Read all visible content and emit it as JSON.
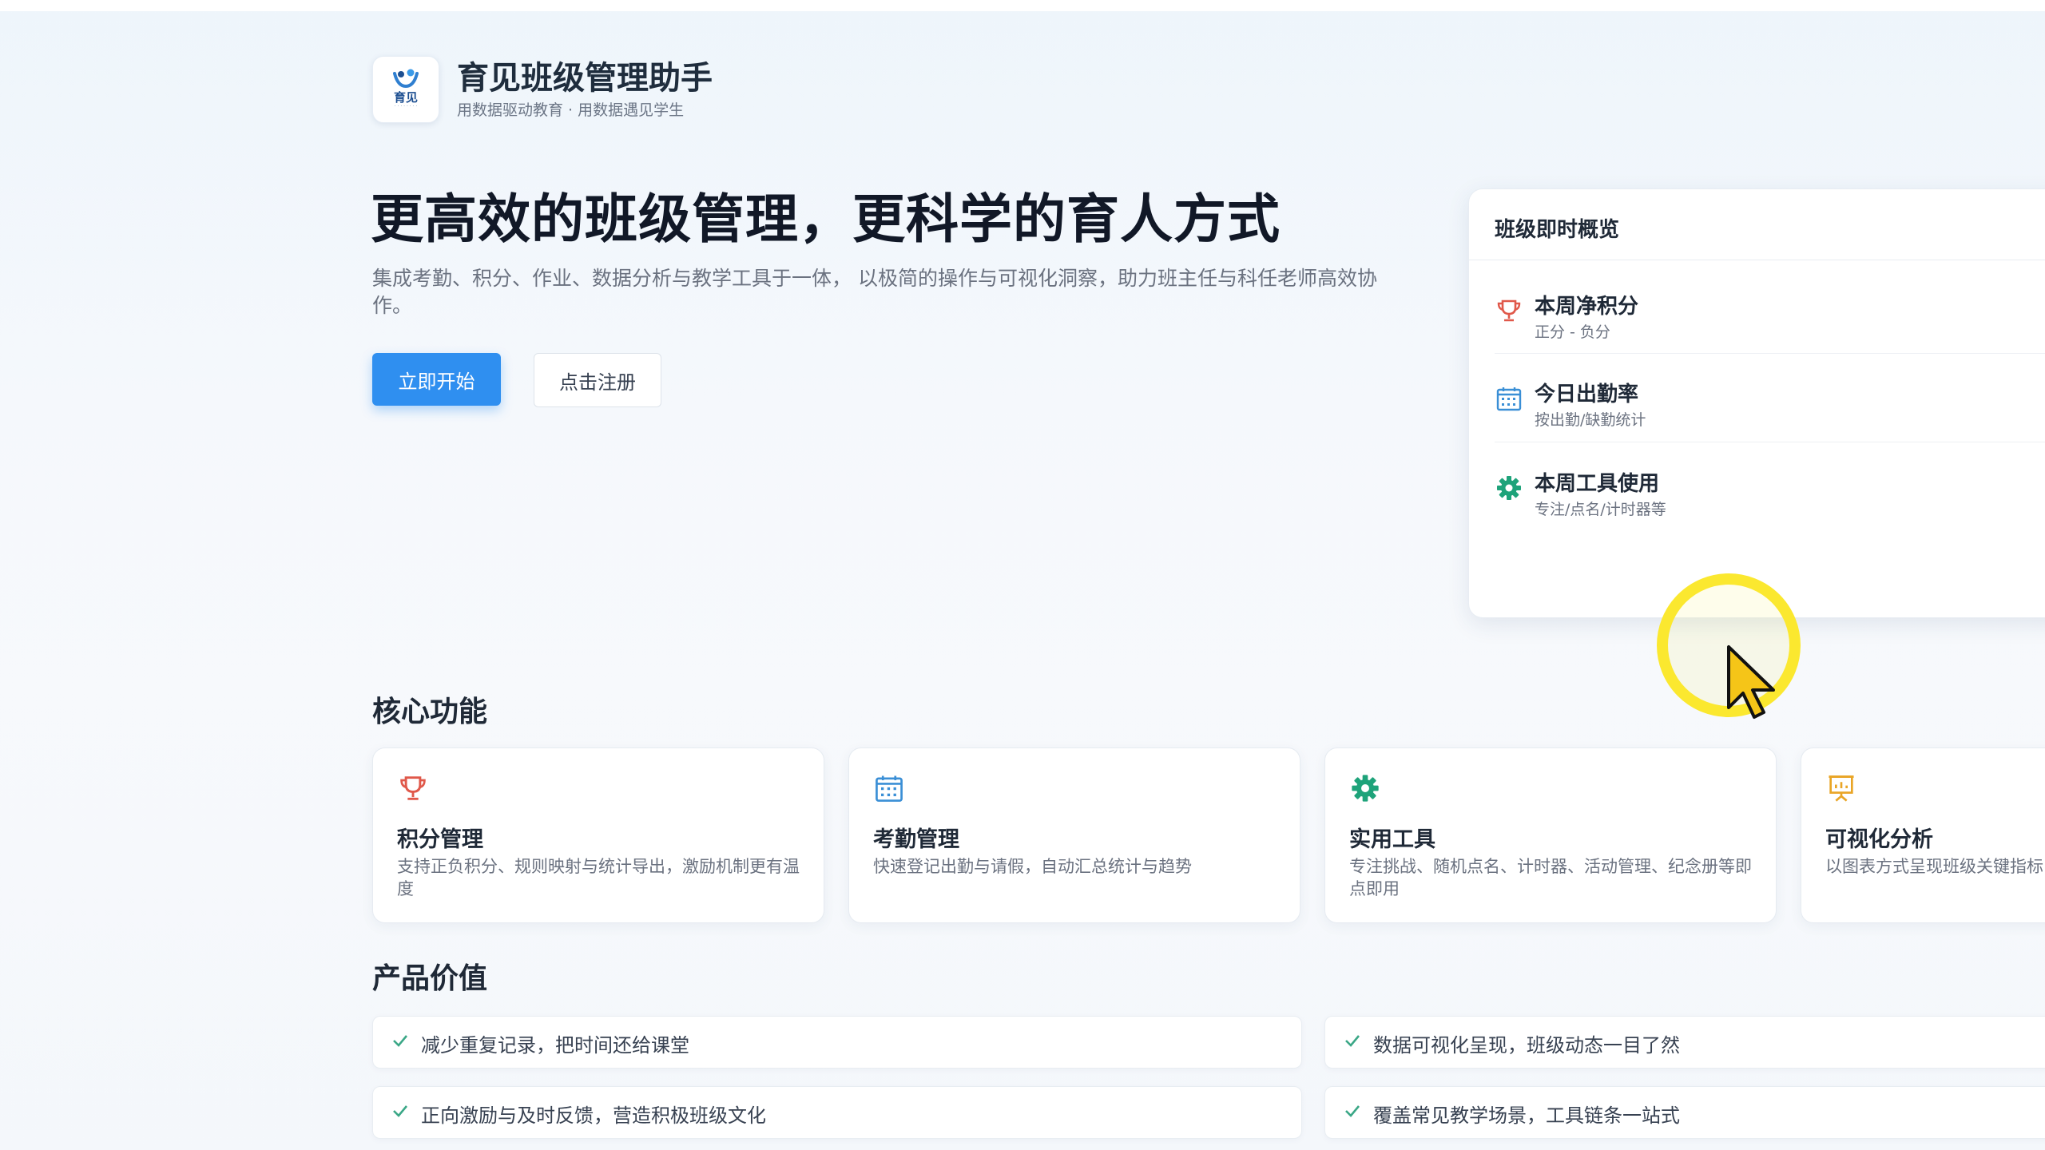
{
  "brand": {
    "logo_text": "育见",
    "title": "育见班级管理助手",
    "slogan": "用数据驱动教育 · 用数据遇见学生"
  },
  "hero": {
    "title": "更高效的班级管理，更科学的育人方式",
    "description": "集成考勤、积分、作业、数据分析与教学工具于一体， 以极简的操作与可视化洞察，助力班主任与科任老师高效协作。",
    "primary_button": "立即开始",
    "secondary_button": "点击注册"
  },
  "overview": {
    "title": "班级即时概览",
    "items": [
      {
        "icon": "trophy-icon",
        "label": "本周净积分",
        "sub": "正分 - 负分"
      },
      {
        "icon": "calendar-icon",
        "label": "今日出勤率",
        "sub": "按出勤/缺勤统计"
      },
      {
        "icon": "gear-icon",
        "label": "本周工具使用",
        "sub": "专注/点名/计时器等"
      }
    ]
  },
  "features": {
    "title": "核心功能",
    "items": [
      {
        "icon": "trophy-icon",
        "title": "积分管理",
        "desc": "支持正负积分、规则映射与统计导出，激励机制更有温度"
      },
      {
        "icon": "calendar-icon",
        "title": "考勤管理",
        "desc": "快速登记出勤与请假，自动汇总统计与趋势"
      },
      {
        "icon": "gear-icon",
        "title": "实用工具",
        "desc": "专注挑战、随机点名、计时器、活动管理、纪念册等即点即用"
      },
      {
        "icon": "presentation-chart-icon",
        "title": "可视化分析",
        "desc": "以图表方式呈现班级关键指标"
      }
    ]
  },
  "values": {
    "title": "产品价值",
    "items": [
      "减少重复记录，把时间还给课堂",
      "数据可视化呈现，班级动态一目了然",
      "正向激励与及时反馈，营造积极班级文化",
      "覆盖常见教学场景，工具链条一站式"
    ]
  },
  "colors": {
    "primary": "#2f8ff0",
    "trophy": "#e0584a",
    "calendar": "#3a8fd6",
    "gear": "#1ea37a",
    "presentation": "#e9a526",
    "check": "#3aa786",
    "cursor_highlight": "#fbe82f"
  }
}
